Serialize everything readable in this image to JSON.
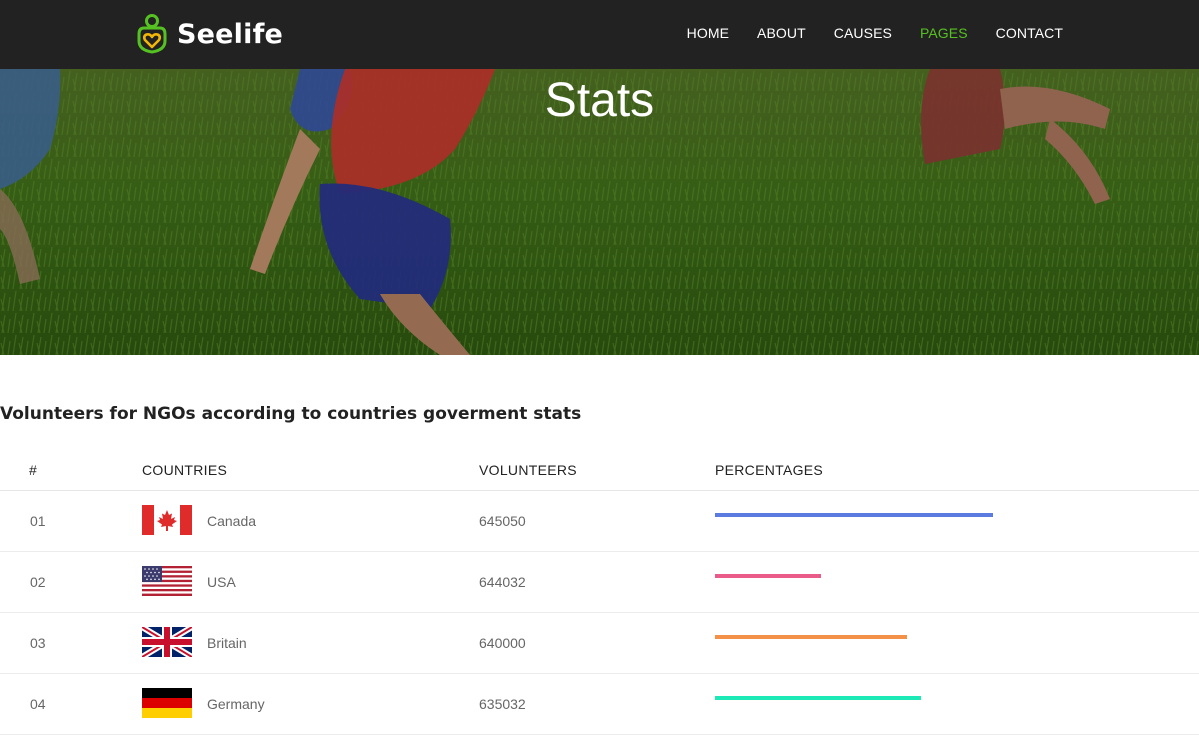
{
  "brand": {
    "name": "Seelife",
    "accent": "#56c122"
  },
  "nav": {
    "items": [
      {
        "label": "HOME",
        "active": false
      },
      {
        "label": "ABOUT",
        "active": false
      },
      {
        "label": "CAUSES",
        "active": false
      },
      {
        "label": "PAGES",
        "active": true
      },
      {
        "label": "CONTACT",
        "active": false
      }
    ]
  },
  "hero": {
    "title": "Stats"
  },
  "stats": {
    "title": "Volunteers for NGOs according to countries goverment stats",
    "headers": {
      "index": "#",
      "countries": "COUNTRIES",
      "volunteers": "VOLUNTEERS",
      "percentages": "PERCENTAGES"
    },
    "rows": [
      {
        "index": "01",
        "country": "Canada",
        "flag": "canada-flag-icon",
        "volunteers": "645050",
        "bar_fraction": 0.58,
        "bar_color": "#5b7be1"
      },
      {
        "index": "02",
        "country": "USA",
        "flag": "usa-flag-icon",
        "volunteers": "644032",
        "bar_fraction": 0.22,
        "bar_color": "#ea5b8a"
      },
      {
        "index": "03",
        "country": "Britain",
        "flag": "britain-flag-icon",
        "volunteers": "640000",
        "bar_fraction": 0.4,
        "bar_color": "#f39148"
      },
      {
        "index": "04",
        "country": "Germany",
        "flag": "germany-flag-icon",
        "volunteers": "635032",
        "bar_fraction": 0.43,
        "bar_color": "#1de9b6"
      }
    ]
  }
}
